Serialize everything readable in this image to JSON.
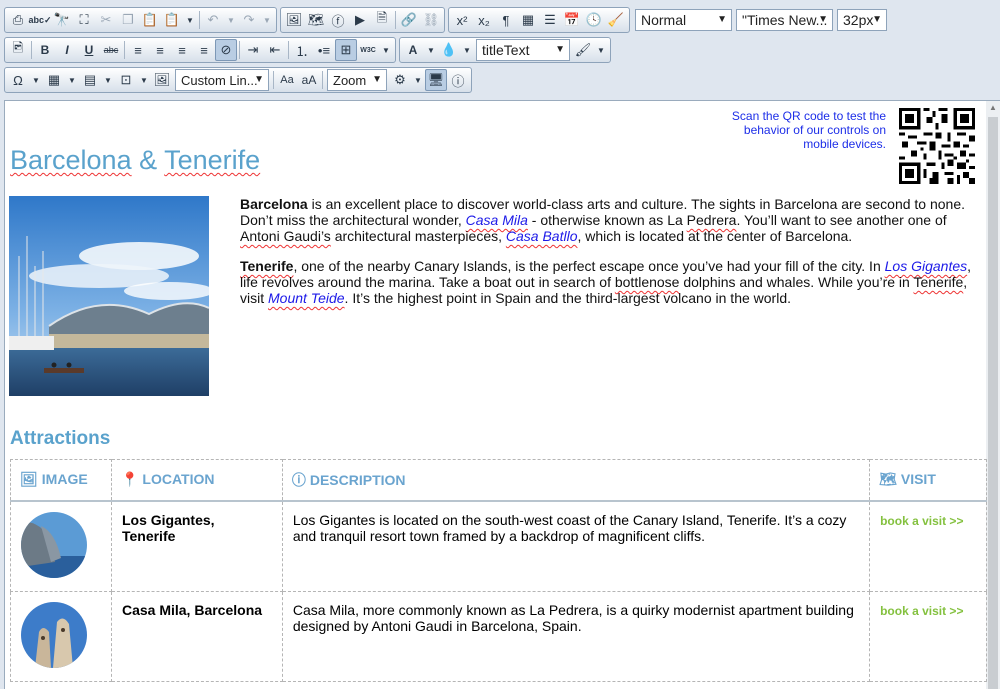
{
  "toolbar": {
    "paragraph_format": "Normal",
    "font_name": "\"Times New...",
    "font_size": "32px",
    "css_class": "titleText",
    "link_style": "Custom Lin...",
    "zoom": "Zoom",
    "text_size_small": "Aa",
    "text_size_large": "aA",
    "superscript": "x²",
    "subscript": "x₂",
    "font_color": "A"
  },
  "qr": {
    "text": "Scan the QR code to test the behavior of our controls on mobile devices."
  },
  "page": {
    "title_part1": "Barcelona",
    "title_amp": " & ",
    "title_part2": "Tenerife"
  },
  "intro": {
    "p1_bold": "Barcelona",
    "p1_a": " is an excellent place to discover world-class arts and culture. The sights in Barcelona are second to none. Don’t miss the architectural wonder, ",
    "p1_link1": "Casa Mila",
    "p1_b": " - otherwise known as La ",
    "p1_pedrera": "Pedrera",
    "p1_c": ". You’ll want to see another one of ",
    "p1_antoni": "Antoni Gaudi’s",
    "p1_d": " architectural masterpieces, ",
    "p1_link2": "Casa Batllo",
    "p1_e": ", which is located at the center of Barcelona.",
    "p2_bold": "Tenerife",
    "p2_a": ", one of the nearby Canary Islands, is the perfect escape once you’ve had your fill of the city. In ",
    "p2_link1": "Los Gigantes",
    "p2_b": ", life revolves around the marina. Take a boat out in search of ",
    "p2_bottlenose": "bottlenose",
    "p2_c": " dolphins and whales. While you’re in ",
    "p2_tenerife": "Tenerife",
    "p2_d": ", visit ",
    "p2_link2": "Mount Teide",
    "p2_e": ". It’s the highest point in Spain and the third-largest volcano in the world."
  },
  "attractions": {
    "title": "Attractions",
    "headers": [
      "IMAGE",
      "LOCATION",
      "DESCRIPTION",
      "VISIT"
    ],
    "rows": [
      {
        "location": "Los Gigantes, Tenerife",
        "description": "Los Gigantes is located on the south-west coast of the Canary Island, Tenerife. It’s a cozy and tranquil resort town framed by a backdrop of magnificent cliffs.",
        "visit": "book a visit >>"
      },
      {
        "location": "Casa Mila, Barcelona",
        "description": "Casa Mila, more commonly known as La Pedrera, is a quirky modernist apartment building designed by Antoni Gaudi in Barcelona, Spain.",
        "visit": "book a visit >>"
      }
    ]
  },
  "colors": {
    "title_blue": "#5aa2cc",
    "link_blue": "#1d1ae8",
    "visit_green": "#84c13f"
  }
}
